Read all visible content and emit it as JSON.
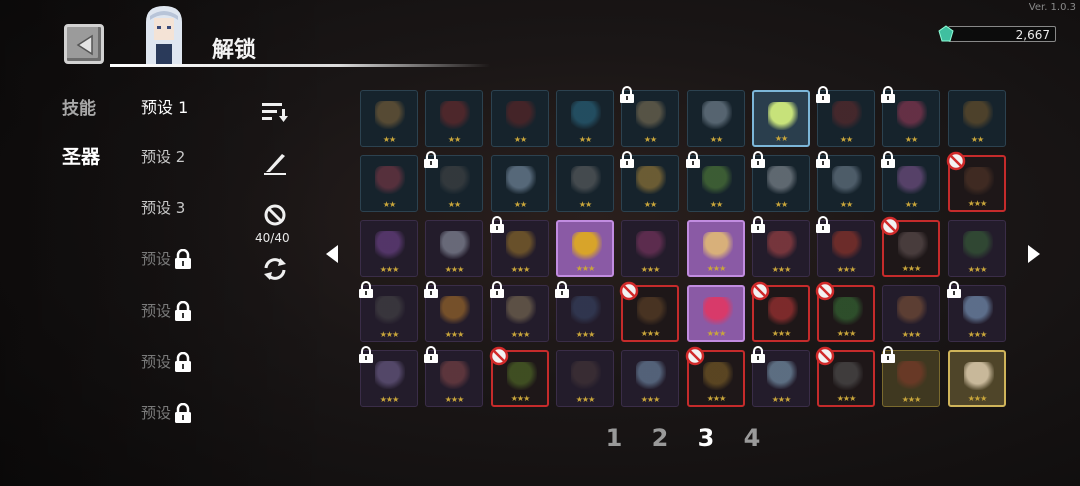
{
  "version": "Ver. 1.0.3",
  "header": {
    "title": "解锁"
  },
  "currency": {
    "value": "2,667"
  },
  "categories": {
    "skills": "技能",
    "relics": "圣器"
  },
  "presets": [
    {
      "label": "预设 1",
      "state": "active"
    },
    {
      "label": "预设 2",
      "state": "normal"
    },
    {
      "label": "预设 3",
      "state": "normal"
    },
    {
      "label": "预设",
      "state": "locked"
    },
    {
      "label": "预设",
      "state": "locked"
    },
    {
      "label": "预设",
      "state": "locked"
    },
    {
      "label": "预设",
      "state": "locked"
    }
  ],
  "tools": {
    "count": "40/40"
  },
  "pagination": {
    "pages": [
      "1",
      "2",
      "3",
      "4"
    ],
    "current": "3"
  },
  "grid": {
    "rows": [
      [
        {
          "style": "blue",
          "stars": "★★",
          "lock": false,
          "no": false,
          "color": "#8a6a3a"
        },
        {
          "style": "blue",
          "stars": "★★",
          "lock": false,
          "no": false,
          "color": "#7a2a2a"
        },
        {
          "style": "blue",
          "stars": "★★",
          "lock": false,
          "no": false,
          "color": "#6a2525"
        },
        {
          "style": "blue",
          "stars": "★★",
          "lock": false,
          "no": false,
          "color": "#2d6f8a"
        },
        {
          "style": "blue",
          "stars": "★★",
          "lock": true,
          "no": false,
          "color": "#8a7a5a"
        },
        {
          "style": "blue",
          "stars": "★★",
          "lock": false,
          "no": false,
          "color": "#8a9aa8"
        },
        {
          "style": "highlight",
          "stars": "★★",
          "lock": false,
          "no": false,
          "color": "#c7e27a"
        },
        {
          "style": "blue",
          "stars": "★★",
          "lock": true,
          "no": false,
          "color": "#6a2b2b"
        },
        {
          "style": "blue",
          "stars": "★★",
          "lock": true,
          "no": false,
          "color": "#a53a5a"
        },
        {
          "style": "blue",
          "stars": "★★",
          "lock": false,
          "no": false,
          "color": "#7a5a2a"
        }
      ],
      [
        {
          "style": "blue",
          "stars": "★★",
          "lock": false,
          "no": false,
          "color": "#8a3a4a"
        },
        {
          "style": "blue",
          "stars": "★★",
          "lock": true,
          "no": false,
          "color": "#4a4a4a"
        },
        {
          "style": "blue",
          "stars": "★★",
          "lock": false,
          "no": false,
          "color": "#8aa0b8"
        },
        {
          "style": "blue",
          "stars": "★★",
          "lock": false,
          "no": false,
          "color": "#6a6a6a"
        },
        {
          "style": "blue",
          "stars": "★★",
          "lock": true,
          "no": false,
          "color": "#b08a3a"
        },
        {
          "style": "blue",
          "stars": "★★",
          "lock": true,
          "no": false,
          "color": "#5a8a3a"
        },
        {
          "style": "blue",
          "stars": "★★",
          "lock": true,
          "no": false,
          "color": "#9aa0a8"
        },
        {
          "style": "blue",
          "stars": "★★",
          "lock": true,
          "no": false,
          "color": "#7a8a9a"
        },
        {
          "style": "blue",
          "stars": "★★",
          "lock": true,
          "no": false,
          "color": "#8a5a9a"
        },
        {
          "style": "red",
          "stars": "★★★",
          "lock": false,
          "no": true,
          "color": "#5a3a2a"
        }
      ],
      [
        {
          "style": "purple",
          "stars": "★★★",
          "lock": false,
          "no": false,
          "color": "#7a4a9a"
        },
        {
          "style": "purple",
          "stars": "★★★",
          "lock": false,
          "no": false,
          "color": "#a0a8b8"
        },
        {
          "style": "purple",
          "stars": "★★★",
          "lock": true,
          "no": false,
          "color": "#a07a2a"
        },
        {
          "style": "hl-purple",
          "stars": "★★★",
          "lock": false,
          "no": false,
          "color": "#d8a42a"
        },
        {
          "style": "purple",
          "stars": "★★★",
          "lock": false,
          "no": false,
          "color": "#8a3a6a"
        },
        {
          "style": "hl-purple",
          "stars": "★★★",
          "lock": false,
          "no": false,
          "color": "#d8b07a"
        },
        {
          "style": "purple",
          "stars": "★★★",
          "lock": true,
          "no": false,
          "color": "#b84a4a"
        },
        {
          "style": "purple",
          "stars": "★★★",
          "lock": true,
          "no": false,
          "color": "#a83a2a"
        },
        {
          "style": "red",
          "stars": "★★★",
          "lock": false,
          "no": true,
          "color": "#6a5a5a"
        },
        {
          "style": "purple",
          "stars": "★★★",
          "lock": false,
          "no": false,
          "color": "#3a6a3a"
        }
      ],
      [
        {
          "style": "purple",
          "stars": "★★★",
          "lock": true,
          "no": false,
          "color": "#4a4a4a"
        },
        {
          "style": "purple",
          "stars": "★★★",
          "lock": true,
          "no": false,
          "color": "#b87a2a"
        },
        {
          "style": "purple",
          "stars": "★★★",
          "lock": true,
          "no": false,
          "color": "#8a7a5a"
        },
        {
          "style": "purple",
          "stars": "★★★",
          "lock": true,
          "no": false,
          "color": "#3a4a6a"
        },
        {
          "style": "red",
          "stars": "★★★",
          "lock": false,
          "no": true,
          "color": "#6a4a2a"
        },
        {
          "style": "hl-purple",
          "stars": "★★★",
          "lock": false,
          "no": false,
          "color": "#d83a6a"
        },
        {
          "style": "red",
          "stars": "★★★",
          "lock": false,
          "no": true,
          "color": "#c83a3a"
        },
        {
          "style": "red",
          "stars": "★★★",
          "lock": false,
          "no": true,
          "color": "#3a7a3a"
        },
        {
          "style": "purple",
          "stars": "★★★",
          "lock": false,
          "no": false,
          "color": "#8a5a3a"
        },
        {
          "style": "purple",
          "stars": "★★★",
          "lock": true,
          "no": false,
          "color": "#8ab0d8"
        }
      ],
      [
        {
          "style": "purple",
          "stars": "★★★",
          "lock": true,
          "no": false,
          "color": "#7a6a9a"
        },
        {
          "style": "purple",
          "stars": "★★★",
          "lock": true,
          "no": false,
          "color": "#8a4a4a"
        },
        {
          "style": "red",
          "stars": "★★★",
          "lock": false,
          "no": true,
          "color": "#5a7a2a"
        },
        {
          "style": "purple",
          "stars": "★★★",
          "lock": false,
          "no": false,
          "color": "#4a3a3a"
        },
        {
          "style": "purple",
          "stars": "★★★",
          "lock": false,
          "no": false,
          "color": "#7a9ab8"
        },
        {
          "style": "red",
          "stars": "★★★",
          "lock": false,
          "no": true,
          "color": "#8a6a2a"
        },
        {
          "style": "purple",
          "stars": "★★★",
          "lock": true,
          "no": false,
          "color": "#8ab0c8"
        },
        {
          "style": "red",
          "stars": "★★★",
          "lock": false,
          "no": true,
          "color": "#5a5a5a"
        },
        {
          "style": "gold",
          "stars": "★★★",
          "lock": true,
          "no": false,
          "color": "#8a3a2a"
        },
        {
          "style": "gold-hl",
          "stars": "★★★",
          "lock": false,
          "no": false,
          "color": "#c8b89a"
        }
      ]
    ]
  }
}
